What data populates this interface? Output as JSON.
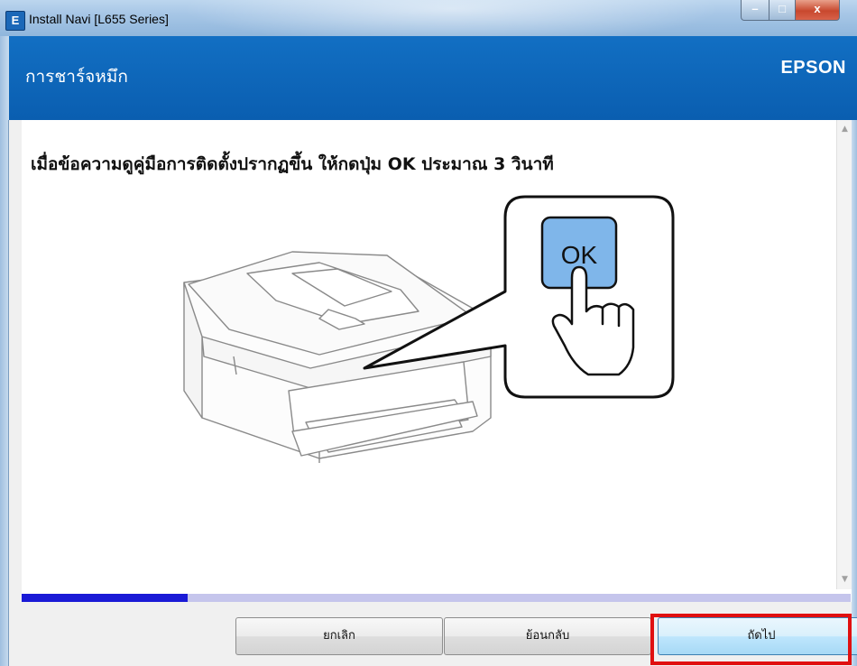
{
  "window": {
    "title": "Install Navi [L655 Series]",
    "app_icon_letter": "E",
    "controls": {
      "minimize": "–",
      "maximize": "□",
      "close": "x"
    }
  },
  "header": {
    "title": "การชาร์จหมึก",
    "brand": "EPSON"
  },
  "content": {
    "instruction": "เมื่อข้อความดูคู่มือการติดตั้งปรากฏขึ้น ให้กดปุ่ม OK ประมาณ 3 วินาที",
    "button_label": "OK",
    "icons": [
      "printer-illustration",
      "hand-pointer-icon",
      "callout-bubble"
    ]
  },
  "progress": {
    "fraction": 0.2
  },
  "footer": {
    "cancel_label": "ยกเลิก",
    "back_label": "ย้อนกลับ",
    "next_label": "ถัดไป"
  },
  "colors": {
    "header_blue": "#0d64b8",
    "progress_fill": "#1a1ad6",
    "progress_track": "#c5c5ec",
    "highlight_red": "#e01010",
    "ok_button_blue": "#7fb6ea"
  }
}
